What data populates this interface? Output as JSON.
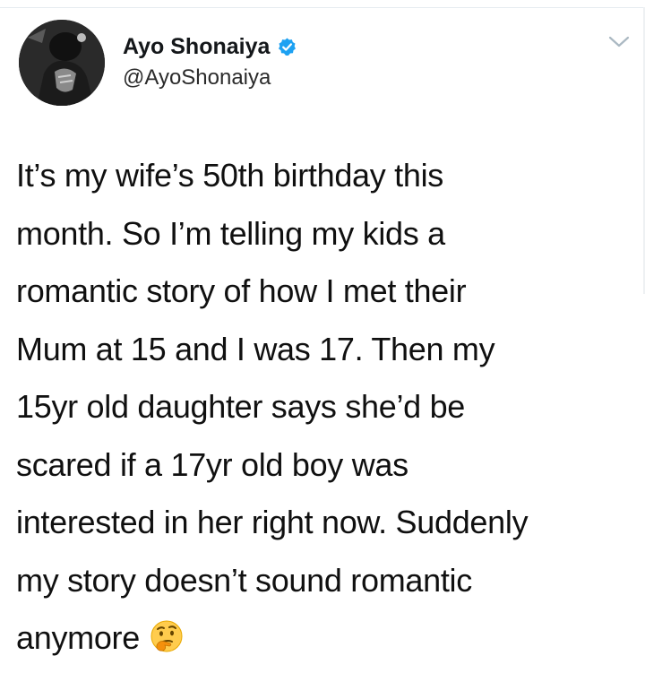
{
  "author": {
    "display_name": "Ayo Shonaiya",
    "handle": "@AyoShonaiya",
    "verified_icon": "verified-badge-icon",
    "avatar_icon": "profile-photo"
  },
  "menu_icon": "chevron-down-icon",
  "tweet": {
    "lines": [
      "It’s my wife’s 50th birthday this",
      "month. So I’m telling my kids a",
      "romantic story of how I met their",
      "Mum at 15 and I was 17. Then my",
      "15yr old daughter says she’d be",
      "scared if a 17yr old boy was",
      "interested in her right now. Suddenly",
      "my story doesn’t sound romantic",
      "anymore"
    ],
    "trailing_emoji": "thinking-face-icon"
  },
  "colors": {
    "verified_blue": "#1da1f2",
    "text": "#14171a",
    "chevron": "#aab8c2"
  }
}
